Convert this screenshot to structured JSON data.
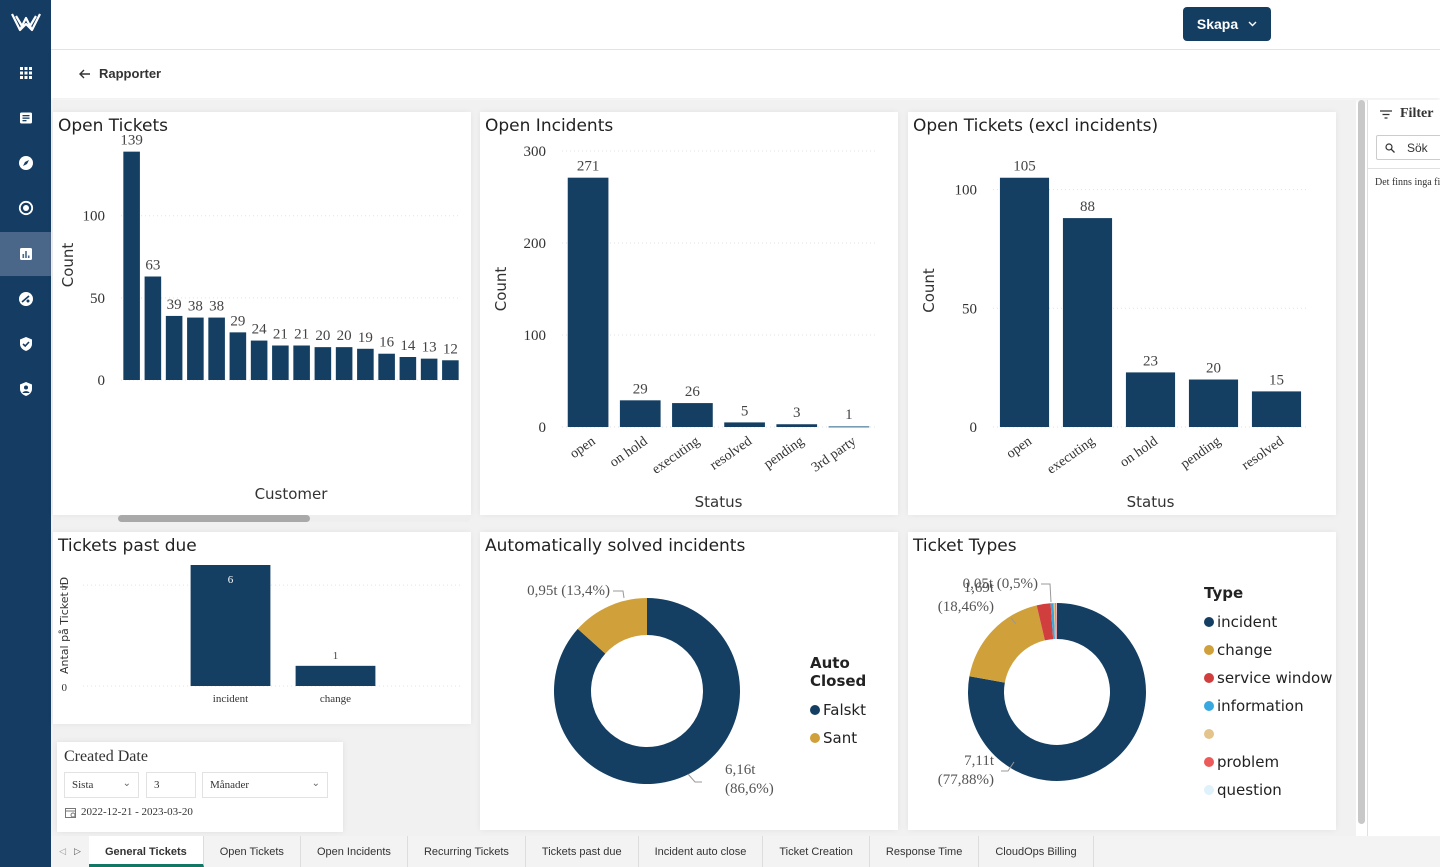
{
  "app": {
    "create_button": "Skapa",
    "breadcrumb_back": "Rapporter"
  },
  "sidebar": {
    "items": [
      {
        "icon": "apps-grid-icon"
      },
      {
        "icon": "inbox-icon"
      },
      {
        "icon": "compass-icon"
      },
      {
        "icon": "monitor-target-icon"
      },
      {
        "icon": "reports-chart-icon",
        "active": true
      },
      {
        "icon": "cost-gauge-icon"
      },
      {
        "icon": "security-shield-icon"
      },
      {
        "icon": "user-shield-icon"
      }
    ]
  },
  "colors": {
    "primary": "#143f62",
    "gold": "#d0a03a",
    "red": "#d13e3e",
    "blue": "#3aa8e0",
    "sand": "#e3c48c",
    "pink": "#ec5a5a",
    "pale": "#dff1fb",
    "tab_active": "#117865"
  },
  "filter_pane": {
    "title": "Filter",
    "search_placeholder": "Sök",
    "empty_text": "Det finns inga filter"
  },
  "date_filter": {
    "title": "Created Date",
    "relative": "Sista",
    "count": "3",
    "unit": "Månader",
    "range": "2022-12-21 - 2023-03-20"
  },
  "tabs": [
    {
      "label": "General Tickets",
      "active": true
    },
    {
      "label": "Open Tickets"
    },
    {
      "label": "Open Incidents"
    },
    {
      "label": "Recurring Tickets"
    },
    {
      "label": "Tickets past due"
    },
    {
      "label": "Incident auto close"
    },
    {
      "label": "Ticket Creation"
    },
    {
      "label": "Response Time"
    },
    {
      "label": "CloudOps Billing"
    }
  ],
  "chart_data": [
    {
      "id": "open-tickets",
      "type": "bar",
      "title": "Open Tickets",
      "xlabel": "Customer",
      "ylabel": "Count",
      "ylim": [
        0,
        140
      ],
      "yticks": [
        0,
        50,
        100
      ],
      "categories": [
        "",
        "",
        "",
        "",
        "",
        "",
        "",
        "",
        "",
        "",
        "",
        "",
        "",
        "",
        "",
        ""
      ],
      "values": [
        139,
        63,
        39,
        38,
        38,
        29,
        24,
        21,
        21,
        20,
        20,
        19,
        16,
        14,
        13,
        12
      ],
      "grid": true
    },
    {
      "id": "open-incidents",
      "type": "bar",
      "title": "Open Incidents",
      "xlabel": "Status",
      "ylabel": "Count",
      "ylim": [
        0,
        300
      ],
      "yticks": [
        0,
        100,
        200,
        300
      ],
      "categories": [
        "open",
        "on hold",
        "executing",
        "resolved",
        "pending",
        "3rd party"
      ],
      "values": [
        271,
        29,
        26,
        5,
        3,
        1
      ],
      "grid": true
    },
    {
      "id": "open-tickets-excl",
      "type": "bar",
      "title": "Open Tickets (excl incidents)",
      "xlabel": "Status",
      "ylabel": "Count",
      "ylim": [
        0,
        115
      ],
      "yticks": [
        0,
        50,
        100
      ],
      "categories": [
        "open",
        "executing",
        "on hold",
        "pending",
        "resolved"
      ],
      "values": [
        105,
        88,
        23,
        20,
        15
      ],
      "grid": true
    },
    {
      "id": "tickets-past-due",
      "type": "bar",
      "title": "Tickets past due",
      "xlabel": "",
      "ylabel": "Antal på Ticket ID",
      "ylim": [
        0,
        6
      ],
      "yticks": [
        0,
        5
      ],
      "categories": [
        "incident",
        "change"
      ],
      "values": [
        6,
        1
      ],
      "grid": true
    },
    {
      "id": "auto-solved",
      "type": "pie",
      "donut": true,
      "title": "Automatically solved incidents",
      "legend_title": "Auto Closed",
      "legend_position": "right",
      "slices": [
        {
          "label": "Falskt",
          "value": 6160,
          "percent": 86.6,
          "data_label": "6,16t (86,6%)",
          "color": "#143f62"
        },
        {
          "label": "Sant",
          "value": 950,
          "percent": 13.4,
          "data_label": "0,95t (13,4%)",
          "color": "#d0a03a"
        }
      ]
    },
    {
      "id": "ticket-types",
      "type": "pie",
      "donut": true,
      "title": "Ticket Types",
      "legend_title": "Type",
      "legend_position": "right",
      "slices": [
        {
          "label": "incident",
          "value": 7110,
          "percent": 77.88,
          "data_label": "7,11t (77,88%)",
          "color": "#143f62"
        },
        {
          "label": "change",
          "value": 1690,
          "percent": 18.46,
          "data_label": "1,69t (18,46%)",
          "color": "#d0a03a"
        },
        {
          "label": "service window",
          "value": 230,
          "percent": 2.5,
          "data_label": "",
          "color": "#d13e3e"
        },
        {
          "label": "information",
          "value": 50,
          "percent": 0.5,
          "data_label": "0,05t (0,5%)",
          "color": "#3aa8e0"
        },
        {
          "label": "",
          "value": 25,
          "percent": 0.3,
          "data_label": "",
          "color": "#e3c48c"
        },
        {
          "label": "problem",
          "value": 20,
          "percent": 0.2,
          "data_label": "",
          "color": "#ec5a5a"
        },
        {
          "label": "question",
          "value": 10,
          "percent": 0.1,
          "data_label": "",
          "color": "#dff1fb"
        }
      ]
    }
  ]
}
